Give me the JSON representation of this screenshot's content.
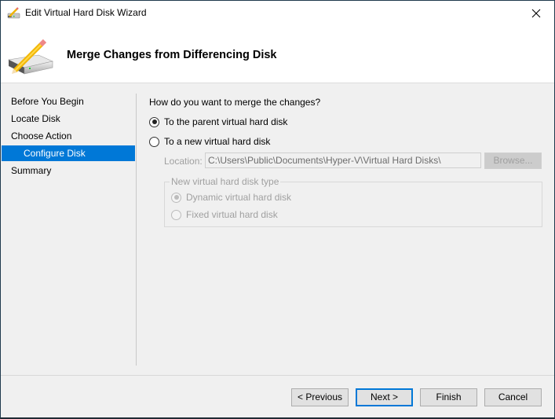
{
  "window": {
    "title": "Edit Virtual Hard Disk Wizard",
    "icon": "hard-disk-pencil-icon"
  },
  "header": {
    "title": "Merge Changes from Differencing Disk",
    "icon": "hard-disk-pencil-icon"
  },
  "nav": {
    "items": [
      {
        "label": "Before You Begin",
        "active": false,
        "sub": false
      },
      {
        "label": "Locate Disk",
        "active": false,
        "sub": false
      },
      {
        "label": "Choose Action",
        "active": false,
        "sub": false
      },
      {
        "label": "Configure Disk",
        "active": true,
        "sub": true
      },
      {
        "label": "Summary",
        "active": false,
        "sub": false
      }
    ]
  },
  "content": {
    "question": "How do you want to merge the changes?",
    "options": [
      {
        "label": "To the parent virtual hard disk",
        "checked": true
      },
      {
        "label": "To a new virtual hard disk",
        "checked": false
      }
    ],
    "location_label": "Location:",
    "location_value": "C:\\Users\\Public\\Documents\\Hyper-V\\Virtual Hard Disks\\",
    "browse_label": "Browse...",
    "disk_type": {
      "legend": "New virtual hard disk type",
      "options": [
        {
          "label": "Dynamic virtual hard disk",
          "checked": true,
          "enabled": false
        },
        {
          "label": "Fixed virtual hard disk",
          "checked": false,
          "enabled": false
        }
      ]
    }
  },
  "buttons": {
    "previous": "< Previous",
    "next": "Next >",
    "finish": "Finish",
    "cancel": "Cancel"
  },
  "colors": {
    "accent": "#0078d7",
    "disabled_text": "#a0a0a0"
  }
}
